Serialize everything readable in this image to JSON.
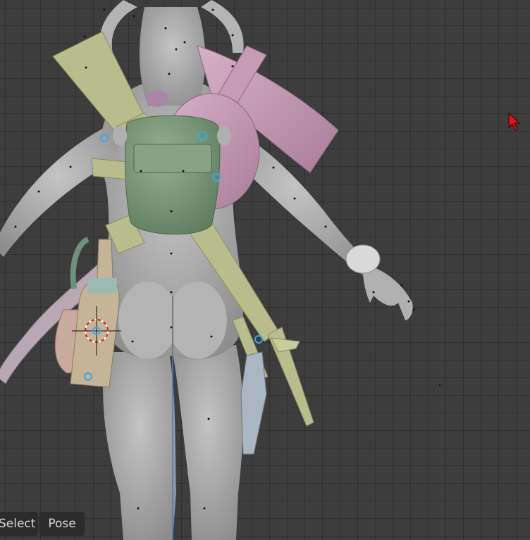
{
  "viewport": {
    "mode_buttons": {
      "select_label": "Select",
      "pose_label": "Pose"
    },
    "cursor_icon": "red-arrow-cursor-icon"
  },
  "colors": {
    "background": "#3d3d3d",
    "body": "#a8a8a8",
    "backpack": "#7d9a7c",
    "rifle": "#b9bc8c",
    "frying_pan": "#c79ab6",
    "bottle": "#c6b496",
    "selection_circle": "#3ea6e6",
    "cursor": "#e01414"
  }
}
